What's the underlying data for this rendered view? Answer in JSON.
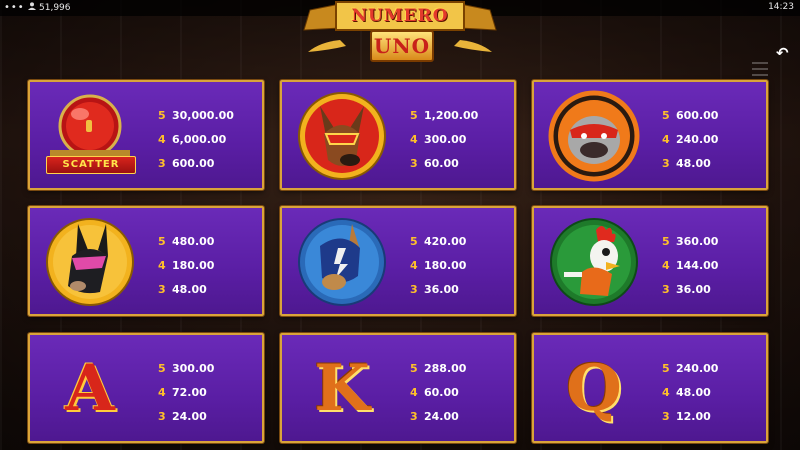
{
  "status_bar": {
    "menu_icon": "menu-dots-icon",
    "balance": "51,996",
    "clock": "14:23"
  },
  "logo": {
    "line1": "NUMERO",
    "line2": "UNO"
  },
  "nav": {
    "back_icon": "back-arrow-icon",
    "back_glyph": "↶"
  },
  "paytable": [
    {
      "symbol": "scatter-bell",
      "symbol_label": "SCATTER",
      "pays": [
        {
          "count": "5",
          "value": "30,000.00"
        },
        {
          "count": "4",
          "value": "6,000.00"
        },
        {
          "count": "3",
          "value": "600.00"
        }
      ]
    },
    {
      "symbol": "doberman-red-mask",
      "pays": [
        {
          "count": "5",
          "value": "1,200.00"
        },
        {
          "count": "4",
          "value": "300.00"
        },
        {
          "count": "3",
          "value": "60.00"
        }
      ]
    },
    {
      "symbol": "bulldog",
      "pays": [
        {
          "count": "5",
          "value": "600.00"
        },
        {
          "count": "4",
          "value": "240.00"
        },
        {
          "count": "3",
          "value": "48.00"
        }
      ]
    },
    {
      "symbol": "doberman-pink-mask",
      "pays": [
        {
          "count": "5",
          "value": "480.00"
        },
        {
          "count": "4",
          "value": "180.00"
        },
        {
          "count": "3",
          "value": "48.00"
        }
      ]
    },
    {
      "symbol": "shepherd-blue-mask",
      "pays": [
        {
          "count": "5",
          "value": "420.00"
        },
        {
          "count": "4",
          "value": "180.00"
        },
        {
          "count": "3",
          "value": "36.00"
        }
      ]
    },
    {
      "symbol": "rooster",
      "pays": [
        {
          "count": "5",
          "value": "360.00"
        },
        {
          "count": "4",
          "value": "144.00"
        },
        {
          "count": "3",
          "value": "36.00"
        }
      ]
    },
    {
      "symbol": "letter-a",
      "glyph": "A",
      "pays": [
        {
          "count": "5",
          "value": "300.00"
        },
        {
          "count": "4",
          "value": "72.00"
        },
        {
          "count": "3",
          "value": "24.00"
        }
      ]
    },
    {
      "symbol": "letter-k",
      "glyph": "K",
      "pays": [
        {
          "count": "5",
          "value": "288.00"
        },
        {
          "count": "4",
          "value": "60.00"
        },
        {
          "count": "3",
          "value": "24.00"
        }
      ]
    },
    {
      "symbol": "letter-q",
      "glyph": "Q",
      "pays": [
        {
          "count": "5",
          "value": "240.00"
        },
        {
          "count": "4",
          "value": "48.00"
        },
        {
          "count": "3",
          "value": "12.00"
        }
      ]
    }
  ],
  "colors": {
    "panel": "#5a1ea4",
    "panel_border": "#d9a43a",
    "count_color": "#ffc02a",
    "value_color": "#ffffff"
  }
}
